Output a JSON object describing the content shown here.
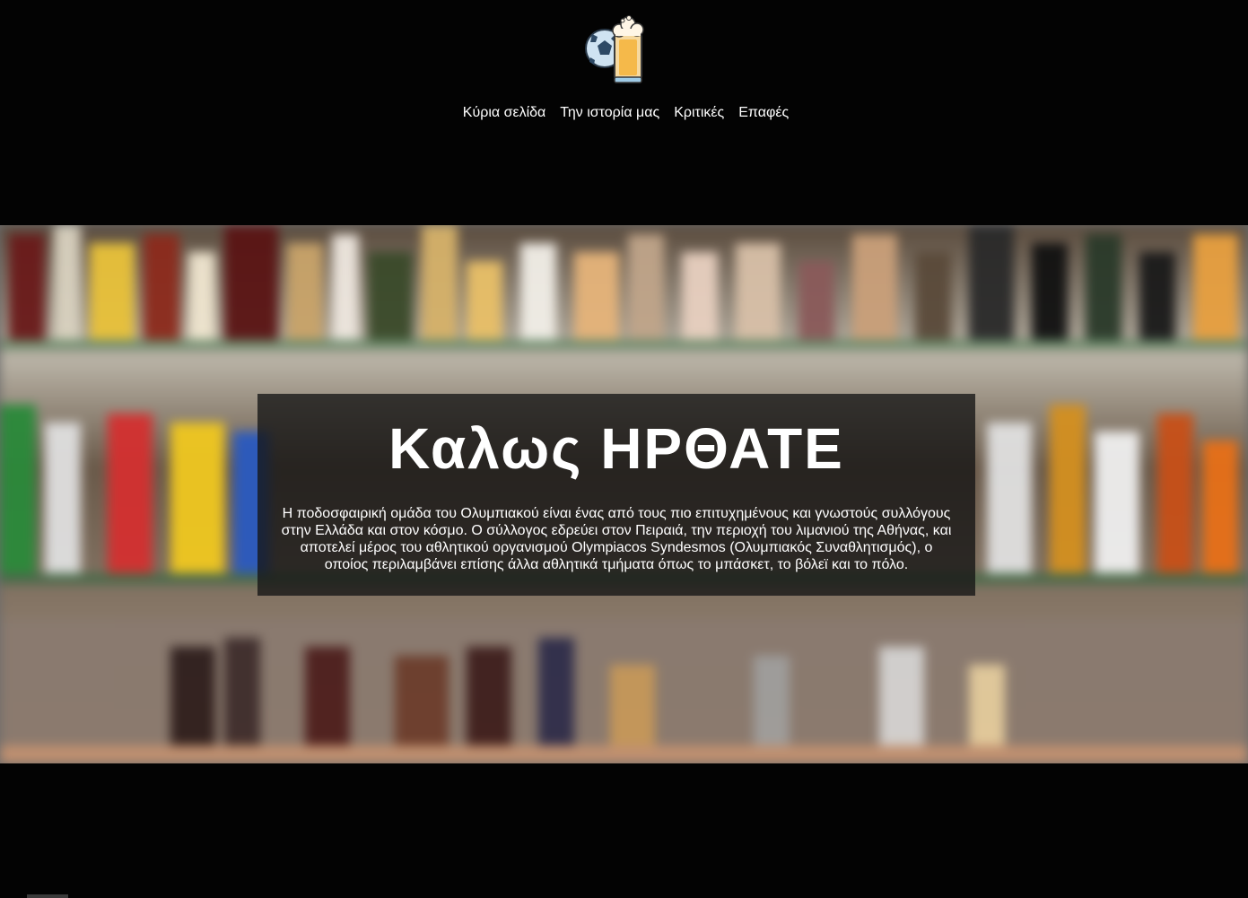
{
  "header": {
    "logo_icon": "football-and-beer-mug-icon",
    "nav": [
      {
        "label": "Κύρια σελίδα"
      },
      {
        "label": "Την ιστορία μας"
      },
      {
        "label": "Κριτικές"
      },
      {
        "label": "Επαφές"
      }
    ]
  },
  "hero": {
    "background": "blurred-bar-bottle-shelves",
    "title": "Καλως ΗΡΘΑΤΕ",
    "text": "Η ποδοσφαιρική ομάδα του Ολυμπιακού είναι ένας από τους πιο επιτυχημένους και γνωστούς συλλόγους στην Ελλάδα και στον κόσμο. Ο σύλλογος εδρεύει στον Πειραιά, την περιοχή του λιμανιού της Αθήνας, και αποτελεί μέρος του αθλητικού οργανισμού Olympiacos Syndesmos (Ολυμπιακός Συναθλητισμός), ο οποίος περιλαμβάνει επίσης άλλα αθλητικά τμήματα όπως το μπάσκετ, το βόλεϊ και το πόλο."
  },
  "colors": {
    "page_background": "#030303",
    "panel_background": "rgba(20,20,20,0.78)",
    "text": "#ffffff"
  }
}
